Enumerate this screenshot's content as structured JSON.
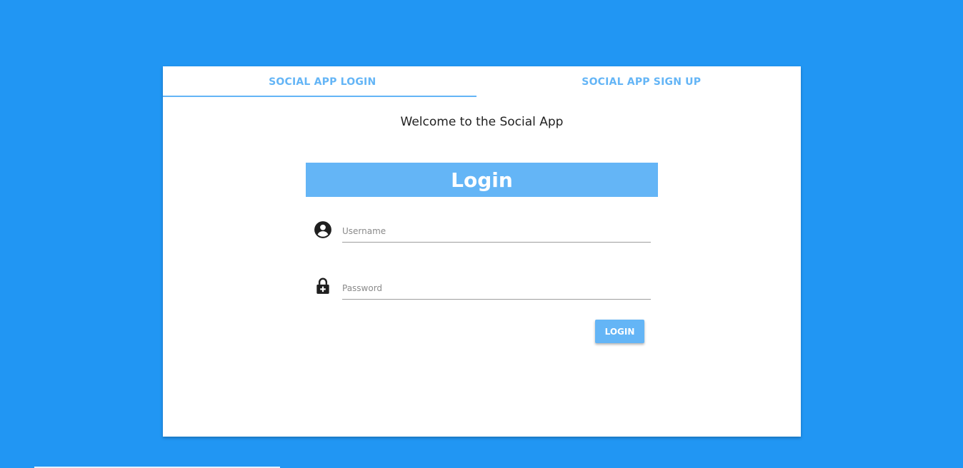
{
  "tabs": [
    {
      "label": "SOCIAL APP LOGIN",
      "active": true
    },
    {
      "label": "SOCIAL APP SIGN UP",
      "active": false
    }
  ],
  "welcome_text": "Welcome to the Social App",
  "login_form": {
    "title": "Login",
    "username": {
      "placeholder": "Username",
      "value": "",
      "icon": "account-circle-icon"
    },
    "password": {
      "placeholder": "Password",
      "value": "",
      "icon": "lock-plus-icon"
    },
    "submit_label": "LOGIN"
  },
  "colors": {
    "background": "#2196f3",
    "accent": "#64b5f6",
    "card": "#ffffff"
  }
}
